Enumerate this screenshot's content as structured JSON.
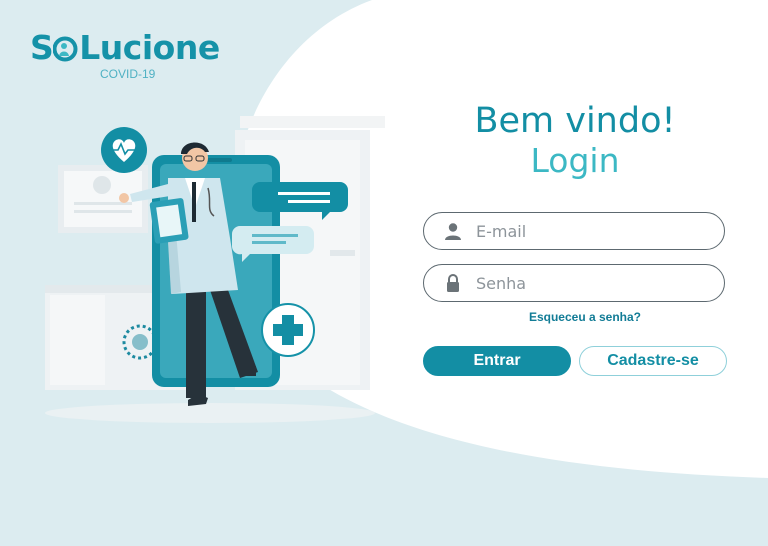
{
  "brand": {
    "logo_prefix": "S",
    "logo_suffix": "Lucione",
    "subtitle": "COVID-19"
  },
  "login": {
    "welcome": "Bem vindo!",
    "title": "Login",
    "email_placeholder": "E-mail",
    "password_placeholder": "Senha",
    "forgot_link": "Esqueceu a senha?",
    "enter_label": "Entrar",
    "register_label": "Cadastre-se"
  },
  "colors": {
    "primary": "#138ea4",
    "accent": "#3cb8c4",
    "background_blob": "#dcecf0"
  },
  "icons": {
    "email_field": "user-icon",
    "password_field": "lock-icon",
    "logo_mark": "person-plus-icon"
  }
}
